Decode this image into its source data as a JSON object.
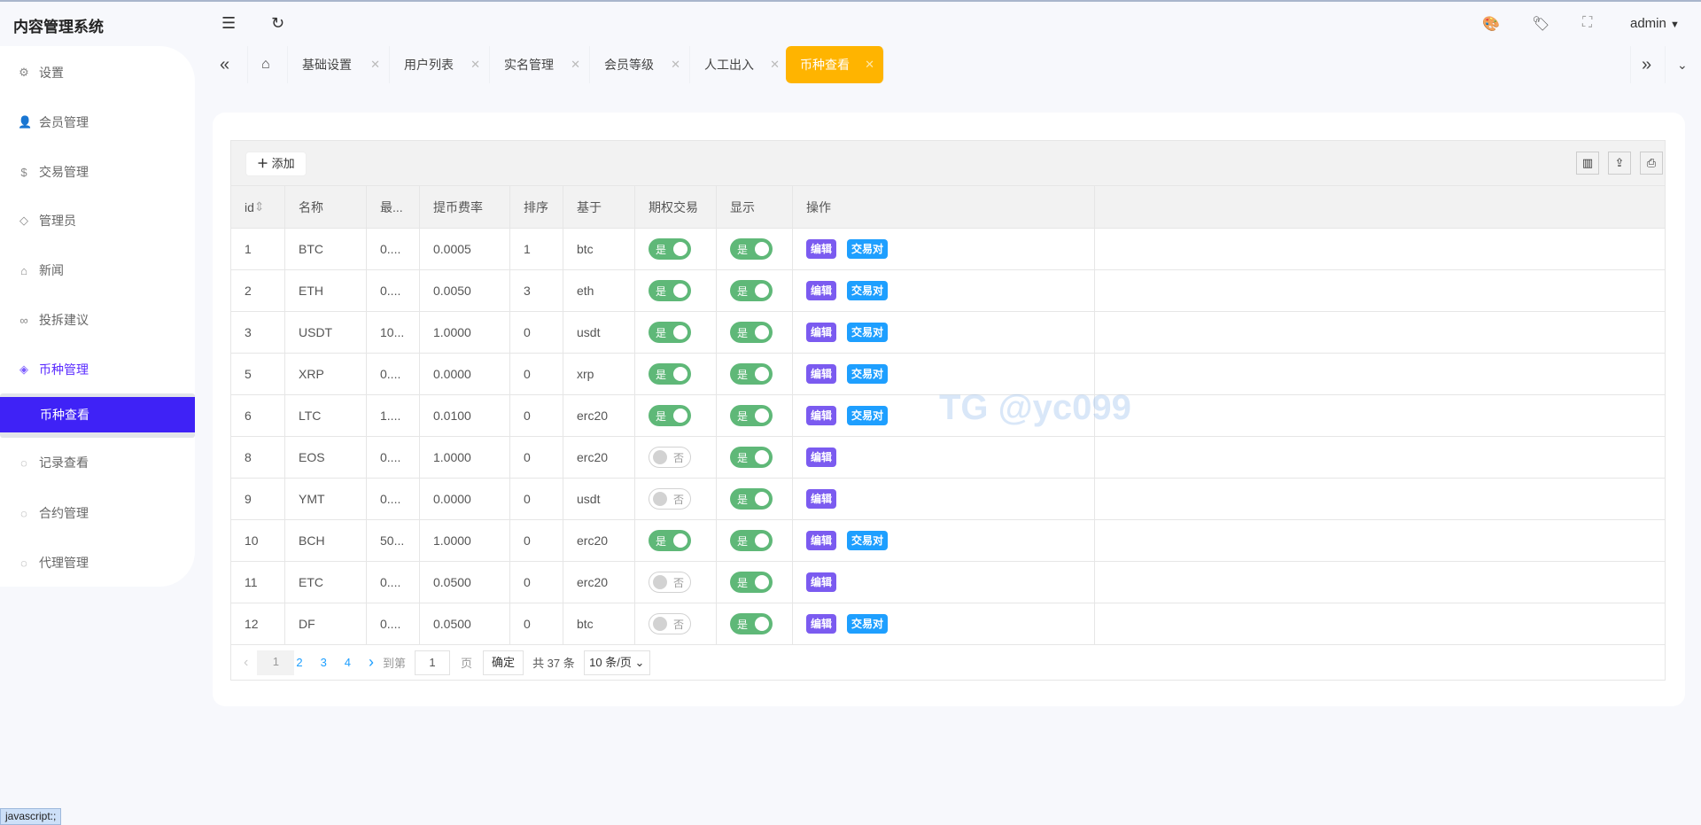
{
  "app": {
    "title": "内容管理系统",
    "user": "admin"
  },
  "sidebar": {
    "items": [
      {
        "label": "设置",
        "icon": "gear-icon"
      },
      {
        "label": "会员管理",
        "icon": "user-icon"
      },
      {
        "label": "交易管理",
        "icon": "dollar-icon"
      },
      {
        "label": "管理员",
        "icon": "shield-icon"
      },
      {
        "label": "新闻",
        "icon": "tag-icon"
      },
      {
        "label": "投拆建议",
        "icon": "link-icon"
      },
      {
        "label": "币种管理",
        "icon": "diamond-icon"
      },
      {
        "label": "记录查看",
        "icon": "circle-icon"
      },
      {
        "label": "合约管理",
        "icon": "circle-icon"
      },
      {
        "label": "代理管理",
        "icon": "circle-icon"
      }
    ],
    "sub_selected": "币种查看"
  },
  "tabs": [
    "基础设置",
    "用户列表",
    "实名管理",
    "会员等级",
    "人工出入",
    "币种查看"
  ],
  "toolbar": {
    "add": "添加"
  },
  "table": {
    "headers": [
      "id",
      "名称",
      "最...",
      "提币费率",
      "排序",
      "基于",
      "期权交易",
      "显示",
      "操作"
    ],
    "rows": [
      {
        "id": "1",
        "name": "BTC",
        "min": "0....",
        "fee": "0.0005",
        "sort": "1",
        "base": "btc",
        "option": true,
        "show": true,
        "pair": true
      },
      {
        "id": "2",
        "name": "ETH",
        "min": "0....",
        "fee": "0.0050",
        "sort": "3",
        "base": "eth",
        "option": true,
        "show": true,
        "pair": true
      },
      {
        "id": "3",
        "name": "USDT",
        "min": "10...",
        "fee": "1.0000",
        "sort": "0",
        "base": "usdt",
        "option": true,
        "show": true,
        "pair": true
      },
      {
        "id": "5",
        "name": "XRP",
        "min": "0....",
        "fee": "0.0000",
        "sort": "0",
        "base": "xrp",
        "option": true,
        "show": true,
        "pair": true
      },
      {
        "id": "6",
        "name": "LTC",
        "min": "1....",
        "fee": "0.0100",
        "sort": "0",
        "base": "erc20",
        "option": true,
        "show": true,
        "pair": true
      },
      {
        "id": "8",
        "name": "EOS",
        "min": "0....",
        "fee": "1.0000",
        "sort": "0",
        "base": "erc20",
        "option": false,
        "show": true,
        "pair": false
      },
      {
        "id": "9",
        "name": "YMT",
        "min": "0....",
        "fee": "0.0000",
        "sort": "0",
        "base": "usdt",
        "option": false,
        "show": true,
        "pair": false
      },
      {
        "id": "10",
        "name": "BCH",
        "min": "50...",
        "fee": "1.0000",
        "sort": "0",
        "base": "erc20",
        "option": true,
        "show": true,
        "pair": true
      },
      {
        "id": "11",
        "name": "ETC",
        "min": "0....",
        "fee": "0.0500",
        "sort": "0",
        "base": "erc20",
        "option": false,
        "show": true,
        "pair": false
      },
      {
        "id": "12",
        "name": "DF",
        "min": "0....",
        "fee": "0.0500",
        "sort": "0",
        "base": "btc",
        "option": false,
        "show": true,
        "pair": true
      }
    ],
    "on": "是",
    "off": "否",
    "edit": "编辑",
    "pair": "交易对"
  },
  "pager": {
    "pages": [
      "1",
      "2",
      "3",
      "4"
    ],
    "goto": "到第",
    "page_input": "1",
    "page_unit": "页",
    "confirm": "确定",
    "total": "共 37 条",
    "size": "10 条/页"
  },
  "watermark": "TG @yc099",
  "status": "javascript:;"
}
